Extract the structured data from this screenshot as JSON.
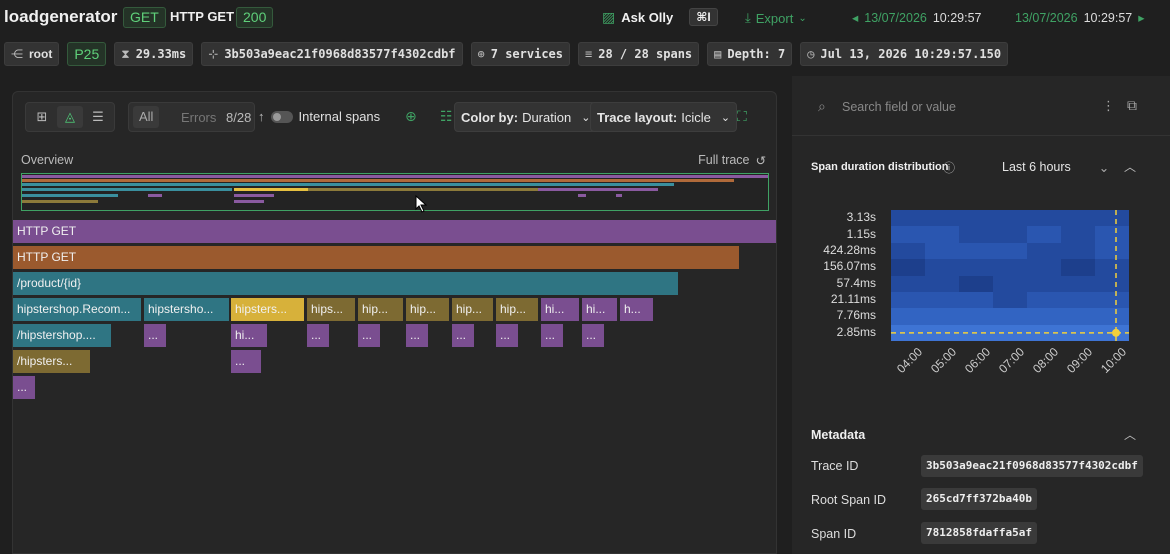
{
  "header": {
    "app_name": "loadgenerator",
    "method": "GET",
    "title": "HTTP GET",
    "status": "200",
    "ask_label": "Ask Olly",
    "shortcut": "⌘I",
    "export_label": "Export",
    "time_prev": "13/07/2026",
    "time_prev_clock": "10:29:57",
    "time_next": "13/07/2026",
    "time_next_clock": "10:29:57"
  },
  "chips": {
    "root": "root",
    "percentile": "P25",
    "duration": "29.33ms",
    "trace_id": "3b503a9eac21f0968d83577f4302cdbf",
    "services": "7 services",
    "spans": "28 / 28 spans",
    "depth": "Depth: 7",
    "timestamp": "Jul 13, 2026 10:29:57.150"
  },
  "toolbar": {
    "all": "All",
    "errors": "Errors",
    "count": "8/28",
    "internal_spans": "Internal spans",
    "color_by_label": "Color by:",
    "color_by_value": "Duration",
    "layout_label": "Trace layout:",
    "layout_value": "Icicle"
  },
  "overview": {
    "label": "Overview",
    "full_trace": "Full trace"
  },
  "spans": {
    "s0": "HTTP GET",
    "s1": "HTTP GET",
    "s2": "/product/{id}",
    "s3a": "hipstershop.Recom...",
    "s3b": "hipstersho...",
    "s3c": "hipsters...",
    "s3d": "hips...",
    "s3e": "hip...",
    "s3f": "hip...",
    "s3g": "hip...",
    "s3h": "hip...",
    "s3i": "hi...",
    "s3j": "hi...",
    "s3k": "h...",
    "s4a": "/hipstershop....",
    "s4b": "...",
    "s4c": "hi...",
    "s4d": "...",
    "s4e": "...",
    "s4f": "...",
    "s4g": "...",
    "s4h": "...",
    "s4i": "...",
    "s4j": "...",
    "s5a": "/hipsters...",
    "s5b": "...",
    "s6a": "..."
  },
  "right": {
    "search_placeholder": "Search field or value",
    "dist_title": "Span duration distribution",
    "range": "Last 6 hours",
    "metadata_title": "Metadata",
    "trace_id_label": "Trace ID",
    "trace_id": "3b503a9eac21f0968d83577f4302cdbf",
    "root_span_label": "Root Span ID",
    "root_span_id": "265cd7ff372ba40b",
    "span_id_label": "Span ID",
    "span_id": "7812858fdaffa5af"
  },
  "chart_data": {
    "type": "heatmap",
    "x": [
      "04:00",
      "05:00",
      "06:00",
      "07:00",
      "08:00",
      "09:00",
      "10:00"
    ],
    "y": [
      "3.13s",
      "1.15s",
      "424.28ms",
      "156.07ms",
      "57.4ms",
      "21.11ms",
      "7.76ms",
      "2.85ms"
    ],
    "scale": "log",
    "values": [
      [
        2,
        2,
        2,
        2,
        2,
        2,
        2
      ],
      [
        3,
        3,
        2,
        2,
        3,
        2,
        3
      ],
      [
        2,
        3,
        3,
        3,
        2,
        2,
        3
      ],
      [
        1,
        2,
        2,
        2,
        2,
        1,
        2
      ],
      [
        2,
        2,
        1,
        2,
        2,
        2,
        2
      ],
      [
        3,
        3,
        3,
        2,
        3,
        3,
        3
      ],
      [
        4,
        4,
        4,
        4,
        4,
        4,
        4
      ],
      [
        5,
        5,
        5,
        5,
        5,
        5,
        5
      ]
    ],
    "highlight": {
      "x": "10:00",
      "y": "2.85ms"
    },
    "colors": [
      "#1d3f8c",
      "#234a9e",
      "#2a56b0",
      "#3264c2",
      "#3e74d4"
    ]
  }
}
